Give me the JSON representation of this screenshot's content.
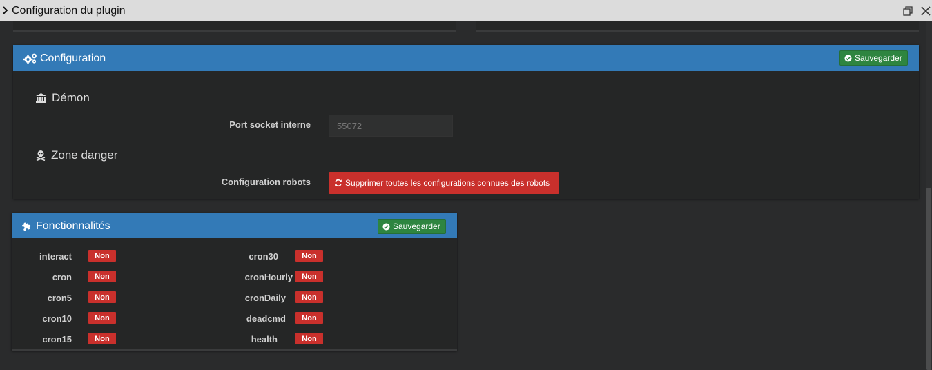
{
  "window": {
    "title": "Configuration du plugin"
  },
  "configuration_panel": {
    "title": "Configuration",
    "save_label": "Sauvegarder",
    "demon": {
      "title": "Démon",
      "port_label": "Port socket interne",
      "port_placeholder": "55072"
    },
    "danger": {
      "title": "Zone danger",
      "robots_label": "Configuration robots",
      "delete_label": "Supprimer toutes les configurations connues des robots"
    }
  },
  "features_panel": {
    "title": "Fonctionnalités",
    "save_label": "Sauvegarder",
    "left": [
      {
        "name": "interact",
        "value": "Non"
      },
      {
        "name": "cron",
        "value": "Non"
      },
      {
        "name": "cron5",
        "value": "Non"
      },
      {
        "name": "cron10",
        "value": "Non"
      },
      {
        "name": "cron15",
        "value": "Non"
      }
    ],
    "right": [
      {
        "name": "cron30",
        "value": "Non"
      },
      {
        "name": "cronHourly",
        "value": "Non"
      },
      {
        "name": "cronDaily",
        "value": "Non"
      },
      {
        "name": "deadcmd",
        "value": "Non"
      },
      {
        "name": "health",
        "value": "Non"
      }
    ]
  },
  "colors": {
    "header_blue": "#337ab7",
    "save_green": "#2e8540",
    "danger_red": "#c9302c",
    "background": "#2a2b2c"
  }
}
